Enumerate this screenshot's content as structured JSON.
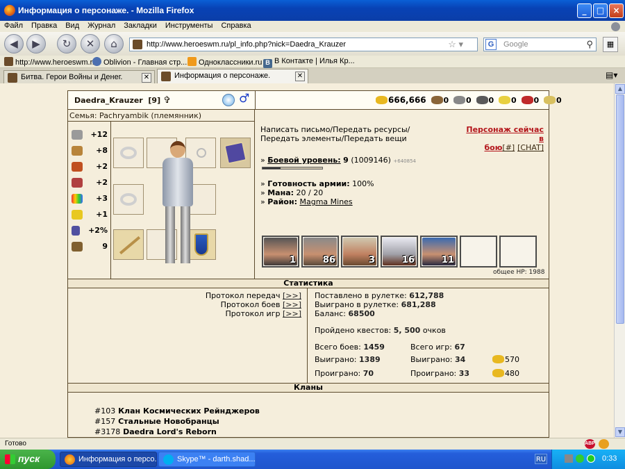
{
  "window": {
    "title": "Информация о персонаже. - Mozilla Firefox"
  },
  "menu": [
    "Файл",
    "Правка",
    "Вид",
    "Журнал",
    "Закладки",
    "Инструменты",
    "Справка"
  ],
  "address": {
    "url": "http://www.heroeswm.ru/pl_info.php?nick=Daedra_Krauzer"
  },
  "search": {
    "placeholder": "Google"
  },
  "bookmarks": [
    "http://www.heroeswm.r...",
    "Oblivion - Главная стр...",
    "Одноклассники.ru",
    "В Контакте | Илья Кр..."
  ],
  "tabs": [
    {
      "label": "Битва. Герои Войны и Денег."
    },
    {
      "label": "Информация о персонаже."
    }
  ],
  "player": {
    "name": "Daedra_Krauzer",
    "level_tag": "[9]",
    "family": "Семья: Pachryambik (племянник)",
    "gold": "666,666",
    "resources": [
      "0",
      "0",
      "0",
      "0",
      "0",
      "0"
    ],
    "stats": [
      "+12",
      "+8",
      "+2",
      "+2",
      "+3",
      "+1",
      "+2%",
      "9"
    ],
    "msg": "Написать письмо/Передать ресурсы/Передать элементы/Передать вещи",
    "online_l1": "Персонаж сейчас в",
    "online_l2": "бою",
    "online_hash": "[#]",
    "online_chat": "[CHAT]",
    "level_label": "Боевой уровень:",
    "level_value": "9",
    "level_exp": "(1009146)",
    "level_next": "+640854",
    "level_progress": 0.3,
    "army_label": "Готовность армии:",
    "army_value": "100%",
    "mana_label": "Мана:",
    "mana_value": "20 / 20",
    "district_label": "Район:",
    "district_value": "Magma Mines",
    "army_units": [
      "1",
      "86",
      "3",
      "16",
      "11",
      "",
      ""
    ],
    "total_hp": "общее HP: 1988"
  },
  "sections": {
    "stats": "Статистика",
    "clans": "Кланы"
  },
  "protocols": [
    {
      "label": "Протокол передач",
      "link": "[>>]"
    },
    {
      "label": "Протокол боев",
      "link": "[>>]"
    },
    {
      "label": "Протокол игр",
      "link": "[>>]"
    }
  ],
  "stats": {
    "roulette_bet_label": "Поставлено в рулетке:",
    "roulette_bet": "612,788",
    "roulette_won_label": "Выиграно в рулетке:",
    "roulette_won": "681,288",
    "balance_label": "Баланс:",
    "balance": "68500",
    "quests_label": "Пройдено квестов:",
    "quests": "5, 500",
    "quests_unit": "очков",
    "battles_label": "Всего боев:",
    "battles": "1459",
    "games_label": "Всего игр:",
    "games": "67",
    "won_label": "Выиграно:",
    "battles_won": "1389",
    "games_won": "34",
    "gold_won": "570",
    "lost_label": "Проиграно:",
    "battles_lost": "70",
    "games_lost": "33",
    "gold_lost": "480"
  },
  "clans": [
    {
      "id": "#103",
      "name": "Клан Космических Рейнджеров"
    },
    {
      "id": "#157",
      "name": "Стальные Новобранцы"
    },
    {
      "id": "#3178",
      "name": "Daedra Lord's Reborn"
    }
  ],
  "status": {
    "text": "Готово"
  },
  "taskbar": {
    "start": "пуск",
    "tasks": [
      "Информация о персо...",
      "Skype™ - darth.shad..."
    ],
    "lang": "RU",
    "clock": "0:33"
  }
}
